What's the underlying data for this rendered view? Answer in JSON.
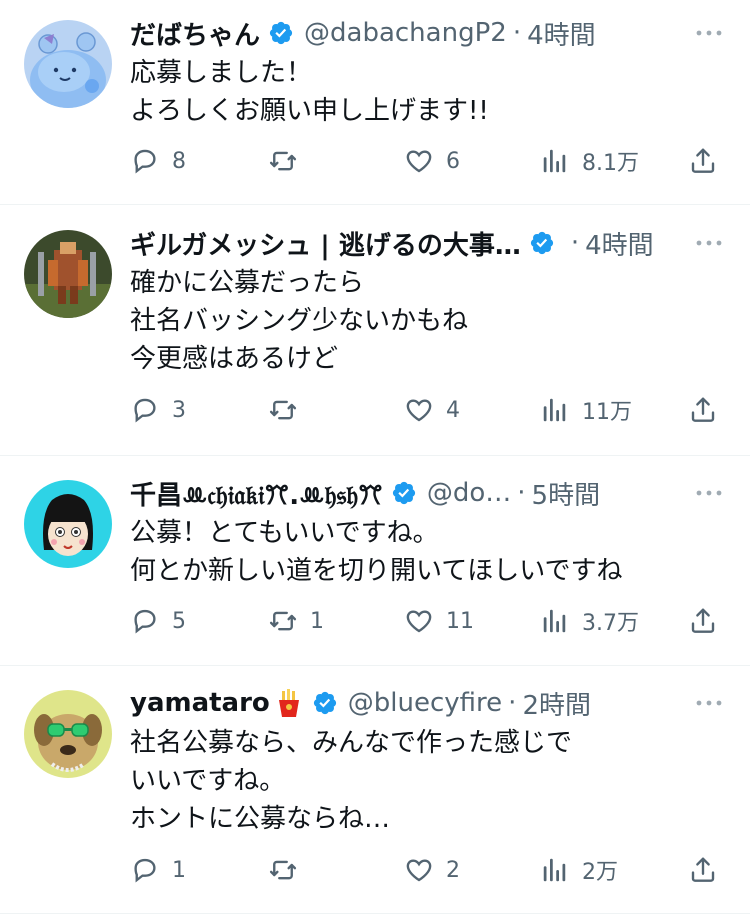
{
  "colors": {
    "text": "#0f1419",
    "secondary": "#536471",
    "verified": "#1d9bf0",
    "divider": "#eff3f4"
  },
  "tweets": [
    {
      "name": "だばちゃん",
      "handle": "@dabachangP2",
      "separator": "·",
      "time": "4時間",
      "verified": true,
      "lines": [
        "応募しました！",
        "よろしくお願い申し上げます!!"
      ],
      "replies": "8",
      "retweets": "",
      "likes": "6",
      "views": "8.1万"
    },
    {
      "name": "ギルガメッシュ | 逃げるの大事…",
      "handle": "",
      "separator": "·",
      "time": "4時間",
      "verified": true,
      "lines": [
        "確かに公募だったら",
        "社名バッシング少ないかもね",
        "今更感はあるけど"
      ],
      "replies": "3",
      "retweets": "",
      "likes": "4",
      "views": "11万"
    },
    {
      "name": "千昌ꔛ𝔠𝔥𝔦𝔞𝔨𝔦ꔫ.ꔛ𝔥𝔰𝔥ꔫ",
      "handle": "@do…",
      "separator": "·",
      "time": "5時間",
      "verified": true,
      "lines": [
        "公募！とてもいいですね。",
        "何とか新しい道を切り開いてほしいですね"
      ],
      "replies": "5",
      "retweets": "1",
      "likes": "11",
      "views": "3.7万"
    },
    {
      "name": "yamataro",
      "name_emoji": "fries-emoji",
      "handle": "@bluecyfire",
      "separator": "·",
      "time": "2時間",
      "verified": true,
      "lines": [
        "社名公募なら、みんなで作った感じで",
        "いいですね。",
        "ホントに公募ならね…"
      ],
      "replies": "1",
      "retweets": "",
      "likes": "2",
      "views": "2万"
    }
  ]
}
